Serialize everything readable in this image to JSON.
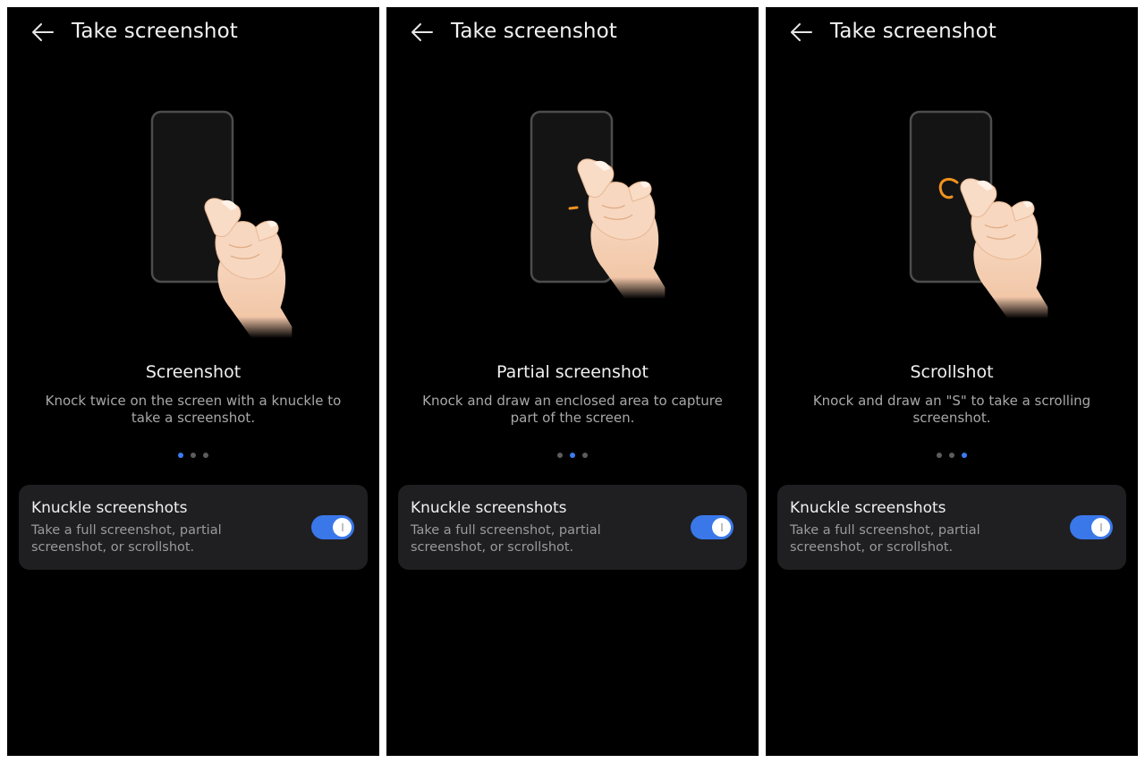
{
  "panels": [
    {
      "header": {
        "title": "Take screenshot",
        "back_icon": "back-arrow-icon"
      },
      "illustration": {
        "gesture": "knock-twice",
        "accent_color": "#f0921f"
      },
      "mode": {
        "title": "Screenshot",
        "description": "Knock twice on the screen with a knuckle to take a screenshot."
      },
      "pager": {
        "count": 3,
        "active_index": 0
      },
      "setting": {
        "title": "Knuckle screenshots",
        "description": "Take a full screenshot, partial screenshot, or scrollshot.",
        "enabled": true
      }
    },
    {
      "header": {
        "title": "Take screenshot",
        "back_icon": "back-arrow-icon"
      },
      "illustration": {
        "gesture": "draw-enclosed-area",
        "accent_color": "#f0921f"
      },
      "mode": {
        "title": "Partial screenshot",
        "description": "Knock and draw an enclosed area to capture part of the screen."
      },
      "pager": {
        "count": 3,
        "active_index": 1
      },
      "setting": {
        "title": "Knuckle screenshots",
        "description": "Take a full screenshot, partial screenshot, or scrollshot.",
        "enabled": true
      }
    },
    {
      "header": {
        "title": "Take screenshot",
        "back_icon": "back-arrow-icon"
      },
      "illustration": {
        "gesture": "draw-s",
        "accent_color": "#f0921f"
      },
      "mode": {
        "title": "Scrollshot",
        "description": "Knock and draw an \"S\" to take a scrolling screenshot."
      },
      "pager": {
        "count": 3,
        "active_index": 2
      },
      "setting": {
        "title": "Knuckle screenshots",
        "description": "Take a full screenshot, partial screenshot, or scrollshot.",
        "enabled": true
      }
    }
  ],
  "colors": {
    "background": "#000000",
    "card": "#1f1f21",
    "accent": "#3a78ea",
    "dot_inactive": "#5c5c5c",
    "text_primary": "#f0f0f0",
    "text_secondary": "#a8a8a8"
  }
}
